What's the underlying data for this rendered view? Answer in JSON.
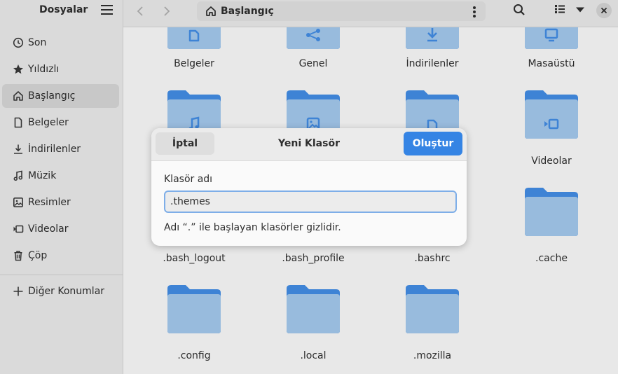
{
  "sidebar": {
    "title": "Dosyalar",
    "menu_icon": "hamburger-menu-icon",
    "items": [
      {
        "label": "Son",
        "icon": "clock-icon"
      },
      {
        "label": "Yıldızlı",
        "icon": "star-icon"
      },
      {
        "label": "Başlangıç",
        "icon": "home-icon",
        "active": true
      },
      {
        "label": "Belgeler",
        "icon": "document-icon"
      },
      {
        "label": "İndirilenler",
        "icon": "download-icon"
      },
      {
        "label": "Müzik",
        "icon": "music-icon"
      },
      {
        "label": "Resimler",
        "icon": "image-icon"
      },
      {
        "label": "Videolar",
        "icon": "video-icon"
      },
      {
        "label": "Çöp",
        "icon": "trash-icon"
      }
    ],
    "other_locations": {
      "label": "Diğer Konumlar",
      "icon": "plus-icon"
    }
  },
  "header": {
    "path_label": "Başlangıç",
    "back_icon": "chevron-left-icon",
    "forward_icon": "chevron-right-icon",
    "search_icon": "search-icon",
    "view_icon": "list-view-icon",
    "view_menu_icon": "chevron-down-icon",
    "close_icon": "close-icon"
  },
  "folders": [
    {
      "name": "Belgeler",
      "emblem": "document-icon"
    },
    {
      "name": "Genel",
      "emblem": "share-icon"
    },
    {
      "name": "İndirilenler",
      "emblem": "download-icon"
    },
    {
      "name": "Masaüstü",
      "emblem": "desktop-icon"
    },
    {
      "name": "",
      "emblem": "music-icon"
    },
    {
      "name": "",
      "emblem": "image-icon"
    },
    {
      "name": "",
      "emblem": "document-icon"
    },
    {
      "name": "Videolar",
      "emblem": "video-icon"
    },
    {
      "name": ".bash_logout",
      "emblem": ""
    },
    {
      "name": ".bash_profile",
      "emblem": ""
    },
    {
      "name": ".bashrc",
      "emblem": ""
    },
    {
      "name": ".cache",
      "emblem": ""
    },
    {
      "name": ".config",
      "emblem": ""
    },
    {
      "name": ".local",
      "emblem": ""
    },
    {
      "name": ".mozilla",
      "emblem": ""
    }
  ],
  "dialog": {
    "cancel_label": "İptal",
    "title": "Yeni Klasör",
    "create_label": "Oluştur",
    "field_label": "Klasör adı",
    "field_value": ".themes",
    "hint": "Adı “.” ile başlayan klasörler gizlidir."
  },
  "colors": {
    "accent": "#3584e4",
    "folder_back": "#438de6",
    "folder_front": "#a4caee"
  }
}
